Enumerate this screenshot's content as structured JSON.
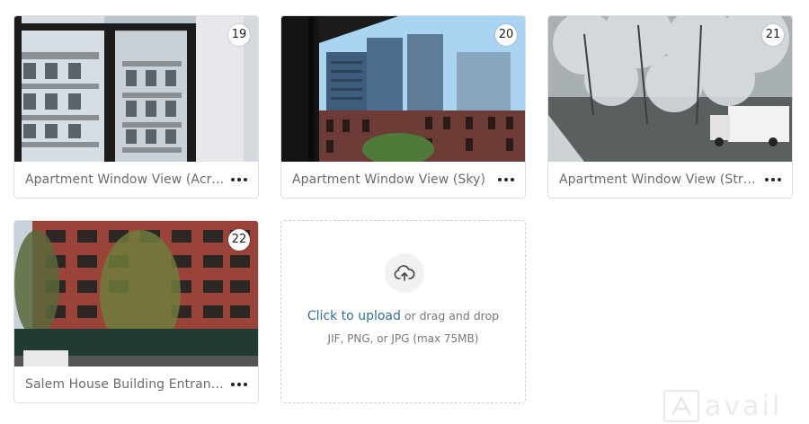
{
  "photos": [
    {
      "number": "19",
      "title": "Apartment Window View (Across Street)",
      "menu_icon": "more-horizontal-icon"
    },
    {
      "number": "20",
      "title": "Apartment Window View (Sky)",
      "menu_icon": "more-horizontal-icon"
    },
    {
      "number": "21",
      "title": "Apartment Window View (Street)",
      "menu_icon": "more-horizontal-icon"
    },
    {
      "number": "22",
      "title": "Salem House Building Entrance",
      "menu_icon": "more-horizontal-icon"
    }
  ],
  "upload": {
    "icon": "cloud-upload-icon",
    "link_text": "Click to upload",
    "text_after_link": " or drag and drop",
    "formats": "JIF, PNG, or JPG (max 75MB)"
  },
  "watermark": {
    "logo_text": "avail"
  },
  "colors": {
    "link": "#2f6f9a",
    "border": "#dedede",
    "dashed_border": "#cfcfcf"
  }
}
